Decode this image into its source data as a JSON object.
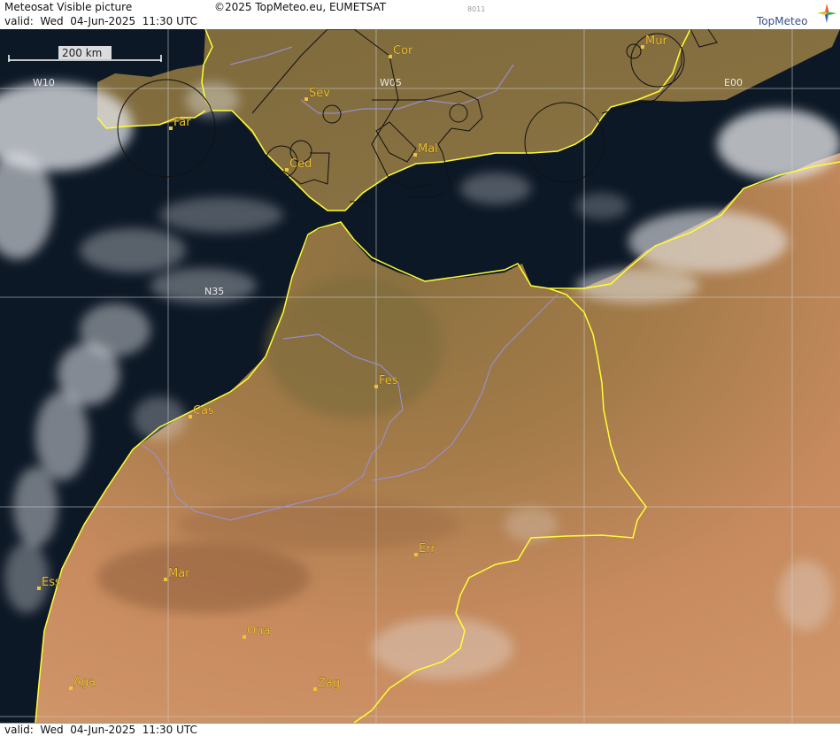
{
  "header": {
    "title": "Meteosat Visible picture",
    "copyright": "©2025 TopMeteo.eu, EUMETSAT",
    "product_code": "8011",
    "valid": "valid:  Wed  04-Jun-2025  11:30 UTC",
    "logo_text": "TopMeteo"
  },
  "footer": {
    "valid": "valid:  Wed  04-Jun-2025  11:30 UTC"
  },
  "scale_bar": {
    "label": "200 km"
  },
  "grid_labels": [
    "W10",
    "W05",
    "E00",
    "N35"
  ],
  "cities": [
    {
      "code": "Cor"
    },
    {
      "code": "Mur"
    },
    {
      "code": "Sev"
    },
    {
      "code": "Far"
    },
    {
      "code": "Ced"
    },
    {
      "code": "Mal"
    },
    {
      "code": "Fes"
    },
    {
      "code": "Cas"
    },
    {
      "code": "Err"
    },
    {
      "code": "Mar"
    },
    {
      "code": "Ess"
    },
    {
      "code": "Oua"
    },
    {
      "code": "Aga"
    },
    {
      "code": "Zag"
    }
  ],
  "colors": {
    "sea": "#0d1826",
    "land_north": "#8a7140",
    "land_south": "#c88860",
    "border": "#ffff33",
    "cloud": "#e6e8ec",
    "city": "#f2c230",
    "grid": "#cfcfcf",
    "river": "#9a90d8"
  }
}
